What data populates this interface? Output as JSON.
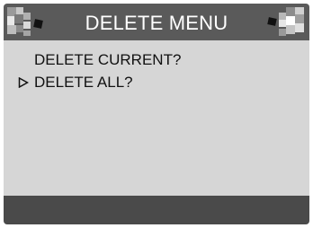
{
  "title": "DELETE MENU",
  "menu": {
    "items": [
      {
        "label": "DELETE CURRENT?",
        "selected": false
      },
      {
        "label": "DELETE ALL?",
        "selected": true
      }
    ],
    "cursor_icon": "triangle-right-outline-icon"
  },
  "colors": {
    "title_bar": "#5a5a5a",
    "body": "#d6d6d6",
    "footer": "#4a4a4a",
    "title_text": "#ffffff",
    "menu_text": "#111111"
  }
}
